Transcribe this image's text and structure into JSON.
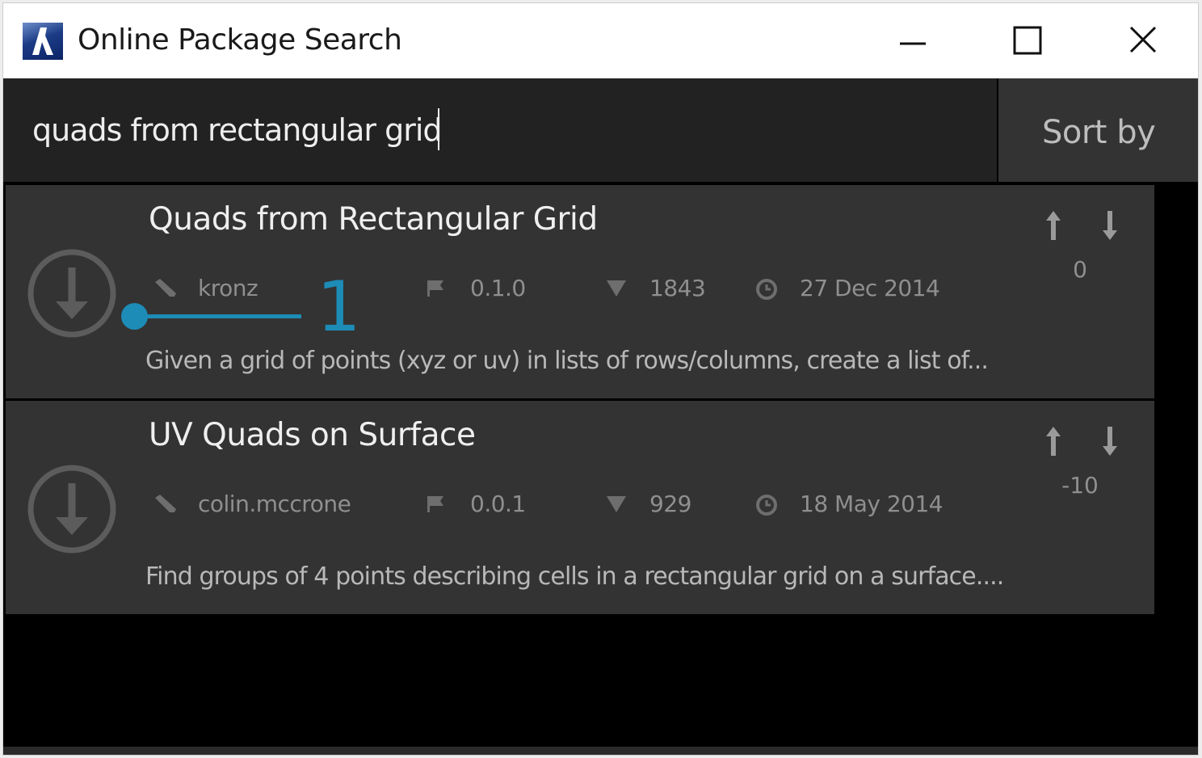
{
  "window": {
    "title": "Online Package Search"
  },
  "search": {
    "value": "quads from rectangular grid",
    "sort_label": "Sort by"
  },
  "packages": [
    {
      "name": "Quads from Rectangular Grid",
      "author": "kronz",
      "version": "0.1.0",
      "downloads": "1843",
      "date": "27 Dec 2014",
      "votes": "0",
      "description": "Given a grid of points (xyz or uv) in lists of rows/columns, create a list of..."
    },
    {
      "name": "UV Quads on Surface",
      "author": "colin.mccrone",
      "version": "0.0.1",
      "downloads": "929",
      "date": "18 May 2014",
      "votes": "-10",
      "description": "Find groups of 4 points describing cells in a rectangular grid on a surface...."
    }
  ],
  "callout": {
    "number": "1",
    "color": "#1d8cb7"
  },
  "icons": {
    "app": "dynamo-logo-icon",
    "download": "download-circle-icon",
    "author": "pencil-icon",
    "version": "flag-icon",
    "downloads": "triangle-down-icon",
    "date": "clock-icon",
    "upvote": "arrow-up-icon",
    "downvote": "arrow-down-icon"
  }
}
